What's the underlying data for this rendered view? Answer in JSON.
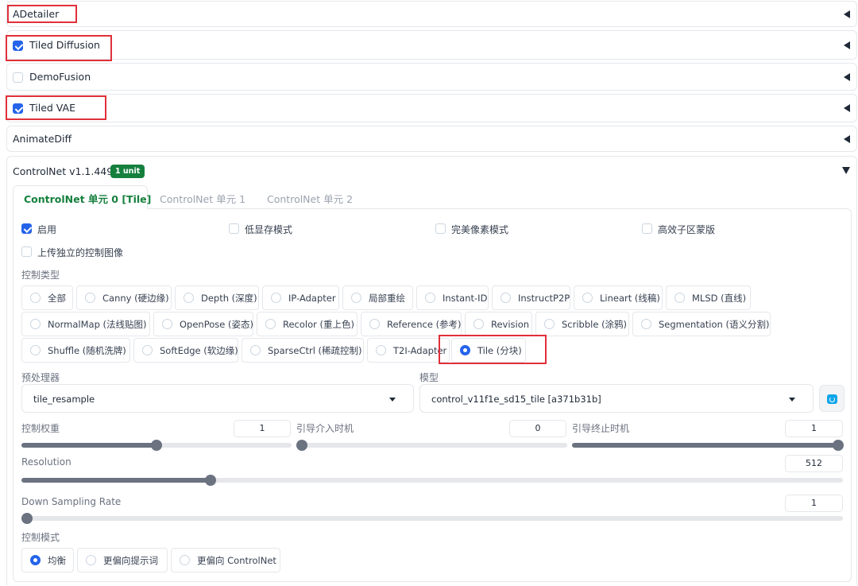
{
  "accordions": {
    "adetailer": {
      "title": "ADetailer"
    },
    "tiled_diffusion": {
      "title": "Tiled Diffusion",
      "checked": true
    },
    "demofusion": {
      "title": "DemoFusion",
      "checked": false
    },
    "tiled_vae": {
      "title": "Tiled VAE",
      "checked": true
    },
    "animatediff": {
      "title": "AnimateDiff"
    }
  },
  "controlnet": {
    "title": "ControlNet v1.1.449",
    "badge": "1 unit",
    "tabs": [
      {
        "label": "ControlNet 单元 0 [Tile]",
        "active": true
      },
      {
        "label": "ControlNet 单元 1",
        "active": false
      },
      {
        "label": "ControlNet 单元 2",
        "active": false
      }
    ],
    "checks": {
      "enable": {
        "label": "启用",
        "checked": true
      },
      "low_vram": {
        "label": "低显存模式",
        "checked": false
      },
      "pixel_perfect": {
        "label": "完美像素模式",
        "checked": false
      },
      "efficient_mask": {
        "label": "高效子区蒙版",
        "checked": false
      },
      "upload_independent": {
        "label": "上传独立的控制图像",
        "checked": false
      }
    },
    "control_type_label": "控制类型",
    "control_types": [
      "全部",
      "Canny (硬边缘)",
      "Depth (深度)",
      "IP-Adapter",
      "局部重绘",
      "Instant-ID",
      "InstructP2P",
      "Lineart (线稿)",
      "MLSD (直线)",
      "NormalMap (法线贴图)",
      "OpenPose (姿态)",
      "Recolor (重上色)",
      "Reference (参考)",
      "Revision",
      "Scribble (涂鸦)",
      "Segmentation (语义分割)",
      "Shuffle (随机洗牌)",
      "SoftEdge (软边缘)",
      "SparseCtrl (稀疏控制)",
      "T2I-Adapter",
      "Tile (分块)"
    ],
    "control_type_selected": "Tile (分块)",
    "preprocessor": {
      "label": "预处理器",
      "value": "tile_resample"
    },
    "model": {
      "label": "模型",
      "value": "control_v11f1e_sd15_tile [a371b31b]"
    },
    "refresh_icon": "refresh-icon",
    "sliders": {
      "weight": {
        "label": "控制权重",
        "value": "1",
        "fraction": 0.5
      },
      "start": {
        "label": "引导介入时机",
        "value": "0",
        "fraction": 0.0
      },
      "end": {
        "label": "引导终止时机",
        "value": "1",
        "fraction": 1.0
      },
      "resolution": {
        "label": "Resolution",
        "value": "512",
        "fraction": 0.23
      },
      "downsampling": {
        "label": "Down Sampling Rate",
        "value": "1",
        "fraction": 0.0
      }
    },
    "control_mode_label": "控制模式",
    "control_modes": [
      "均衡",
      "更偏向提示词",
      "更偏向 ControlNet"
    ],
    "control_mode_selected": "均衡"
  },
  "colors": {
    "accent": "#2563eb",
    "badge": "#15803d",
    "highlight": "#e0303a"
  }
}
